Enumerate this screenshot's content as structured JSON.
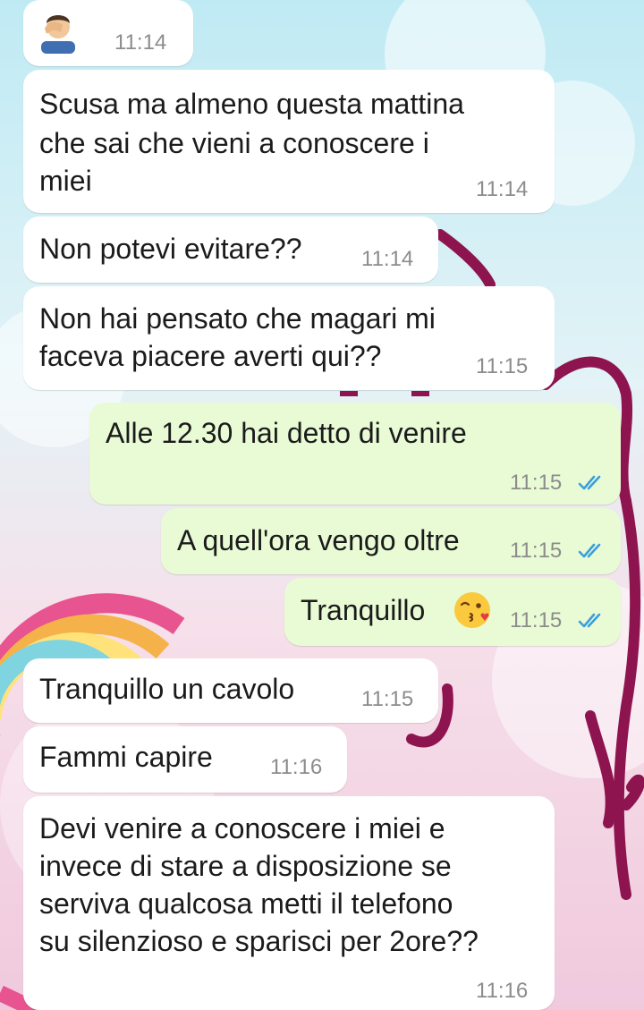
{
  "colors": {
    "incoming_bubble": "#ffffff",
    "outgoing_bubble": "#e9fbd5",
    "read_ticks": "#3a9fdc",
    "timestamp": "#8c8c8c"
  },
  "messages": [
    {
      "direction": "in",
      "icon": "facepalm-emoji",
      "time": "11:14"
    },
    {
      "direction": "in",
      "lines": [
        "Scusa ma almeno questa mattina",
        "che sai che vieni a conoscere i",
        "miei"
      ],
      "time": "11:14"
    },
    {
      "direction": "in",
      "lines": [
        "Non potevi evitare??"
      ],
      "time": "11:14"
    },
    {
      "direction": "in",
      "lines": [
        "Non hai pensato che magari mi",
        "faceva piacere averti qui??"
      ],
      "time": "11:15"
    },
    {
      "direction": "out",
      "lines": [
        "Alle 12.30 hai detto di venire"
      ],
      "time": "11:15",
      "status": "read"
    },
    {
      "direction": "out",
      "lines": [
        "A quell'ora vengo oltre"
      ],
      "time": "11:15",
      "status": "read"
    },
    {
      "direction": "out",
      "lines": [
        "Tranquillo"
      ],
      "icon": "kissing-face-emoji",
      "time": "11:15",
      "status": "read"
    },
    {
      "direction": "in",
      "lines": [
        "Tranquillo un cavolo"
      ],
      "time": "11:15"
    },
    {
      "direction": "in",
      "lines": [
        "Fammi capire"
      ],
      "time": "11:16"
    },
    {
      "direction": "in",
      "lines": [
        "Devi venire a conoscere i miei e",
        "invece di stare a disposizione se",
        "serviva qualcosa metti il telefono",
        "su silenzioso e sparisci per 2ore??"
      ],
      "time": "11:16"
    }
  ]
}
